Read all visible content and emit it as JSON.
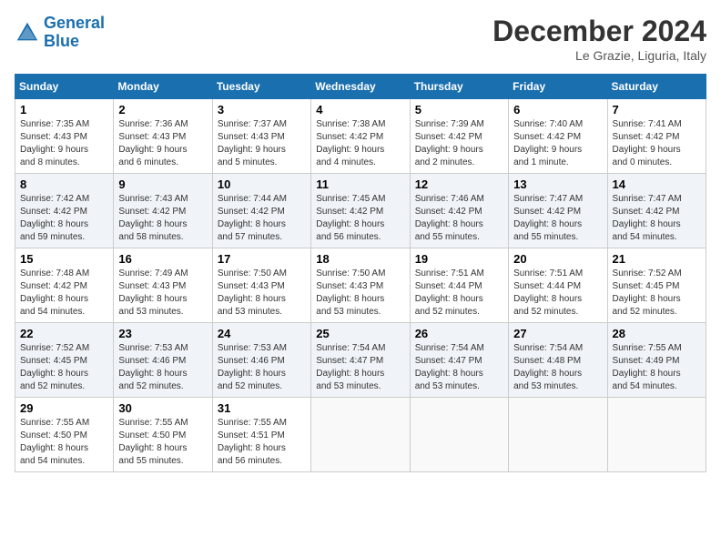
{
  "header": {
    "logo_line1": "General",
    "logo_line2": "Blue",
    "month": "December 2024",
    "location": "Le Grazie, Liguria, Italy"
  },
  "days_of_week": [
    "Sunday",
    "Monday",
    "Tuesday",
    "Wednesday",
    "Thursday",
    "Friday",
    "Saturday"
  ],
  "weeks": [
    [
      {
        "day": "1",
        "info": "Sunrise: 7:35 AM\nSunset: 4:43 PM\nDaylight: 9 hours\nand 8 minutes."
      },
      {
        "day": "2",
        "info": "Sunrise: 7:36 AM\nSunset: 4:43 PM\nDaylight: 9 hours\nand 6 minutes."
      },
      {
        "day": "3",
        "info": "Sunrise: 7:37 AM\nSunset: 4:43 PM\nDaylight: 9 hours\nand 5 minutes."
      },
      {
        "day": "4",
        "info": "Sunrise: 7:38 AM\nSunset: 4:42 PM\nDaylight: 9 hours\nand 4 minutes."
      },
      {
        "day": "5",
        "info": "Sunrise: 7:39 AM\nSunset: 4:42 PM\nDaylight: 9 hours\nand 2 minutes."
      },
      {
        "day": "6",
        "info": "Sunrise: 7:40 AM\nSunset: 4:42 PM\nDaylight: 9 hours\nand 1 minute."
      },
      {
        "day": "7",
        "info": "Sunrise: 7:41 AM\nSunset: 4:42 PM\nDaylight: 9 hours\nand 0 minutes."
      }
    ],
    [
      {
        "day": "8",
        "info": "Sunrise: 7:42 AM\nSunset: 4:42 PM\nDaylight: 8 hours\nand 59 minutes."
      },
      {
        "day": "9",
        "info": "Sunrise: 7:43 AM\nSunset: 4:42 PM\nDaylight: 8 hours\nand 58 minutes."
      },
      {
        "day": "10",
        "info": "Sunrise: 7:44 AM\nSunset: 4:42 PM\nDaylight: 8 hours\nand 57 minutes."
      },
      {
        "day": "11",
        "info": "Sunrise: 7:45 AM\nSunset: 4:42 PM\nDaylight: 8 hours\nand 56 minutes."
      },
      {
        "day": "12",
        "info": "Sunrise: 7:46 AM\nSunset: 4:42 PM\nDaylight: 8 hours\nand 55 minutes."
      },
      {
        "day": "13",
        "info": "Sunrise: 7:47 AM\nSunset: 4:42 PM\nDaylight: 8 hours\nand 55 minutes."
      },
      {
        "day": "14",
        "info": "Sunrise: 7:47 AM\nSunset: 4:42 PM\nDaylight: 8 hours\nand 54 minutes."
      }
    ],
    [
      {
        "day": "15",
        "info": "Sunrise: 7:48 AM\nSunset: 4:42 PM\nDaylight: 8 hours\nand 54 minutes."
      },
      {
        "day": "16",
        "info": "Sunrise: 7:49 AM\nSunset: 4:43 PM\nDaylight: 8 hours\nand 53 minutes."
      },
      {
        "day": "17",
        "info": "Sunrise: 7:50 AM\nSunset: 4:43 PM\nDaylight: 8 hours\nand 53 minutes."
      },
      {
        "day": "18",
        "info": "Sunrise: 7:50 AM\nSunset: 4:43 PM\nDaylight: 8 hours\nand 53 minutes."
      },
      {
        "day": "19",
        "info": "Sunrise: 7:51 AM\nSunset: 4:44 PM\nDaylight: 8 hours\nand 52 minutes."
      },
      {
        "day": "20",
        "info": "Sunrise: 7:51 AM\nSunset: 4:44 PM\nDaylight: 8 hours\nand 52 minutes."
      },
      {
        "day": "21",
        "info": "Sunrise: 7:52 AM\nSunset: 4:45 PM\nDaylight: 8 hours\nand 52 minutes."
      }
    ],
    [
      {
        "day": "22",
        "info": "Sunrise: 7:52 AM\nSunset: 4:45 PM\nDaylight: 8 hours\nand 52 minutes."
      },
      {
        "day": "23",
        "info": "Sunrise: 7:53 AM\nSunset: 4:46 PM\nDaylight: 8 hours\nand 52 minutes."
      },
      {
        "day": "24",
        "info": "Sunrise: 7:53 AM\nSunset: 4:46 PM\nDaylight: 8 hours\nand 52 minutes."
      },
      {
        "day": "25",
        "info": "Sunrise: 7:54 AM\nSunset: 4:47 PM\nDaylight: 8 hours\nand 53 minutes."
      },
      {
        "day": "26",
        "info": "Sunrise: 7:54 AM\nSunset: 4:47 PM\nDaylight: 8 hours\nand 53 minutes."
      },
      {
        "day": "27",
        "info": "Sunrise: 7:54 AM\nSunset: 4:48 PM\nDaylight: 8 hours\nand 53 minutes."
      },
      {
        "day": "28",
        "info": "Sunrise: 7:55 AM\nSunset: 4:49 PM\nDaylight: 8 hours\nand 54 minutes."
      }
    ],
    [
      {
        "day": "29",
        "info": "Sunrise: 7:55 AM\nSunset: 4:50 PM\nDaylight: 8 hours\nand 54 minutes."
      },
      {
        "day": "30",
        "info": "Sunrise: 7:55 AM\nSunset: 4:50 PM\nDaylight: 8 hours\nand 55 minutes."
      },
      {
        "day": "31",
        "info": "Sunrise: 7:55 AM\nSunset: 4:51 PM\nDaylight: 8 hours\nand 56 minutes."
      },
      {
        "day": "",
        "info": ""
      },
      {
        "day": "",
        "info": ""
      },
      {
        "day": "",
        "info": ""
      },
      {
        "day": "",
        "info": ""
      }
    ]
  ]
}
